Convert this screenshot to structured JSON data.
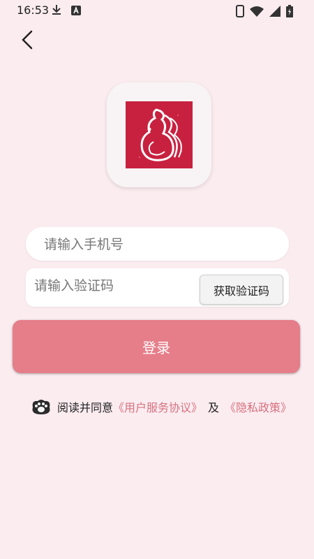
{
  "status_bar": {
    "time": "16:53"
  },
  "login_form": {
    "phone_placeholder": "请输入手机号",
    "code_placeholder": "请输入验证码",
    "get_code_label": "获取验证码",
    "login_label": "登录"
  },
  "agreement": {
    "prefix": "阅读并同意",
    "terms_link": "《用户服务协议》",
    "and": "及",
    "privacy_link": "《隐私政策》"
  },
  "colors": {
    "background": "#fbecf0",
    "accent": "#e57e89",
    "link": "#d6727f",
    "logo": "#c8213f"
  }
}
